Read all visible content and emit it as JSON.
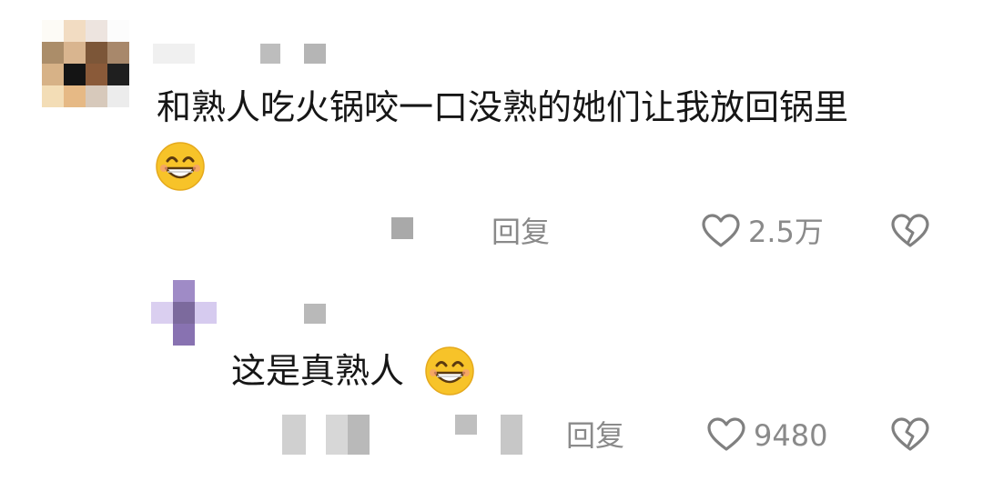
{
  "comments": [
    {
      "text": "和熟人吃火锅咬一口没熟的她们让我放回锅里",
      "emoji": "grinning-sweat-face",
      "reply_label": "回复",
      "like_count": "2.5万"
    },
    {
      "text": "这是真熟人",
      "emoji": "grinning-sweat-face",
      "reply_label": "回复",
      "like_count": "9480"
    }
  ],
  "colors": {
    "text": "#161616",
    "meta": "#8a8a8a",
    "icon_stroke": "#808080",
    "emoji_face": "#f7c329",
    "purple_avatar": "#8a74b4"
  },
  "icons": {
    "like": "heart-outline-icon",
    "dislike": "broken-heart-icon"
  }
}
